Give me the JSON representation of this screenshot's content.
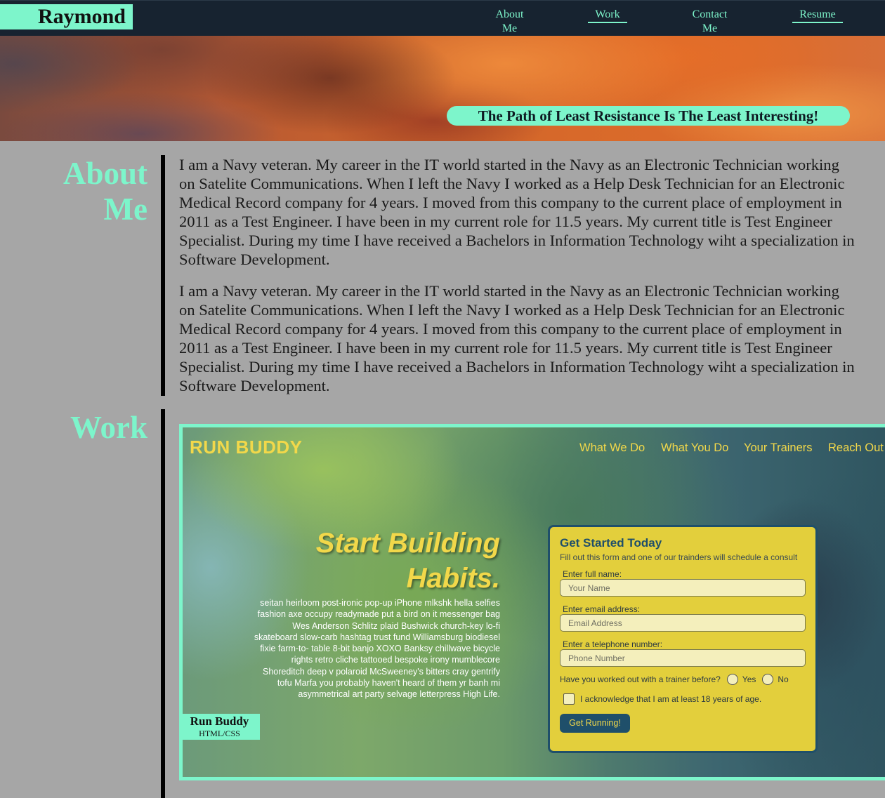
{
  "header": {
    "brand": "Raymond",
    "nav": [
      {
        "label": "About Me"
      },
      {
        "label": "Work"
      },
      {
        "label": "Contact Me"
      },
      {
        "label": "Resume"
      }
    ]
  },
  "hero": {
    "tagline": "The Path of Least Resistance Is The Least Interesting!"
  },
  "about": {
    "title_line1": "About",
    "title_line2": "Me",
    "paragraphs": [
      "I am a Navy veteran. My career in the IT world started in the Navy as an Electronic Technician working on Satelite Communications. When I left the Navy I worked as a Help Desk Technician for an Electronic Medical Record company for 4 years. I moved from this company to the current place of employment in 2011 as a Test Engineer. I have been in my current role for 11.5 years. My current title is Test Engineer Specialist. During my time I have received a Bachelors in Information Technology wiht a specialization in Software Development.",
      "I am a Navy veteran. My career in the IT world started in the Navy as an Electronic Technician working on Satelite Communications. When I left the Navy I worked as a Help Desk Technician for an Electronic Medical Record company for 4 years. I moved from this company to the current place of employment in 2011 as a Test Engineer. I have been in my current role for 11.5 years. My current title is Test Engineer Specialist. During my time I have received a Bachelors in Information Technology wiht a specialization in Software Development."
    ]
  },
  "work": {
    "title": "Work",
    "projects": [
      {
        "name": "Run Buddy",
        "tech": "HTML/CSS",
        "preview": {
          "logo": "RUN BUDDY",
          "nav": [
            "What We Do",
            "What You Do",
            "Your Trainers",
            "Reach Out"
          ],
          "hero_title_line1": "Start Building",
          "hero_title_line2": "Habits.",
          "hero_body": "seitan heirloom post-ironic pop-up iPhone mlkshk hella selfies fashion axe occupy readymade put a bird on it messenger bag Wes Anderson Schlitz plaid Bushwick church-key lo-fi skateboard slow-carb hashtag trust fund Williamsburg biodiesel fixie farm-to- table 8-bit banjo XOXO Banksy chillwave bicycle rights retro cliche tattooed bespoke irony mumblecore Shoreditch deep v polaroid McSweeney's bitters cray gentrify tofu Marfa you probably haven't heard of them yr banh mi asymmetrical art party selvage letterpress High Life.",
          "form": {
            "title": "Get Started Today",
            "subtitle": "Fill out this form and one of our trainders will schedule a consult",
            "name_label": "Enter full name:",
            "name_placeholder": "Your Name",
            "email_label": "Enter email address:",
            "email_placeholder": "Email Address",
            "phone_label": "Enter a telephone number:",
            "phone_placeholder": "Phone Number",
            "trainer_question": "Have you worked out with a trainer before?",
            "yes_label": "Yes",
            "no_label": "No",
            "ack_label": "I acknowledge that I am at least 18 years of age.",
            "submit_label": "Get Running!"
          }
        }
      }
    ]
  },
  "colors": {
    "accent": "#7df5cb",
    "header_bg": "#172330",
    "page_bg": "#a6a6a6",
    "runbuddy_yellow": "#f2d84a",
    "runbuddy_blue": "#1f4f6a"
  }
}
